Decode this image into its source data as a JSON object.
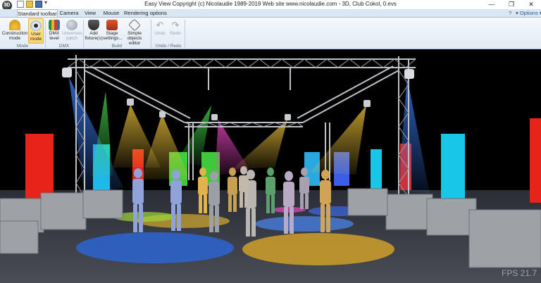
{
  "window": {
    "title": "Easy View   Copyright (c) Nicolaudie 1989-2019   Web site www.nicolaudie.com - 3D, Club Cokol, 0.evs",
    "logo_text": "3D",
    "minimize_glyph": "—",
    "maximize_glyph": "❐",
    "close_glyph": "✕"
  },
  "quick_access": {
    "dropdown_glyph": "▾"
  },
  "tabs": [
    {
      "label": "Standard toolbar",
      "active": true
    },
    {
      "label": "Camera",
      "active": false
    },
    {
      "label": "View",
      "active": false
    },
    {
      "label": "Mouse",
      "active": false
    },
    {
      "label": "Rendering options",
      "active": false
    }
  ],
  "help_label": "?",
  "options_label": "▾ Options ▾",
  "ribbon": {
    "groups": [
      {
        "label": "Mode"
      },
      {
        "label": "DMX"
      },
      {
        "label": "Build"
      },
      {
        "label": "Undo / Redo"
      }
    ],
    "buttons": [
      {
        "label": "Construction mode",
        "icon": "hardhat-icon",
        "state": "normal"
      },
      {
        "label": "User mode",
        "icon": "eye-icon",
        "state": "selected"
      },
      {
        "label": "DMX level",
        "icon": "dmx-grid-icon",
        "state": "normal"
      },
      {
        "label": "Universes patch",
        "icon": "globe-icon",
        "state": "disabled"
      },
      {
        "label": "Add fixture(s)",
        "icon": "fixture-icon",
        "state": "normal"
      },
      {
        "label": "Stage settings...",
        "icon": "stage-icon",
        "state": "normal"
      },
      {
        "label": "Simple objects editor",
        "icon": "cube-icon",
        "state": "normal"
      },
      {
        "label": "Undo",
        "icon": "undo-icon",
        "state": "disabled"
      },
      {
        "label": "Redo",
        "icon": "redo-icon",
        "state": "disabled"
      }
    ]
  },
  "viewport": {
    "fps_label": "FPS 21.7"
  },
  "colors": {
    "ribbon_bg": "#e2ebf6",
    "selected_button": "#ffd36a",
    "viewport_bg": "#000000",
    "beam_blue": "#2f6fd8",
    "beam_yellow": "#f3c73b",
    "beam_green": "#3fd14a",
    "beam_magenta": "#e23fb4"
  }
}
